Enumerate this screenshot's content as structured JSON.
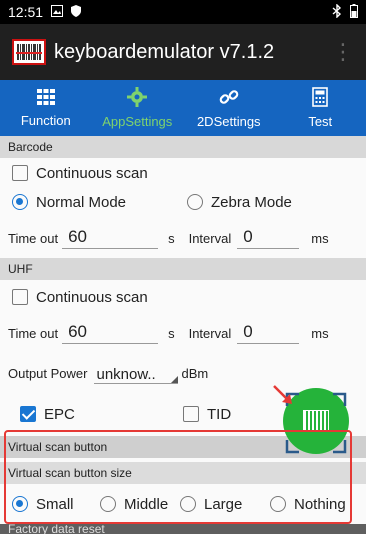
{
  "status_bar": {
    "time": "12:51",
    "icons_left": [
      "image-icon",
      "shield-icon"
    ],
    "icons_right": [
      "bluetooth-icon",
      "battery-icon"
    ]
  },
  "app_bar": {
    "title": "keyboardemulator v7.1.2"
  },
  "tabs": [
    {
      "label": "Function",
      "icon": "grid-icon",
      "active": false
    },
    {
      "label": "AppSettings",
      "icon": "gear-icon",
      "active": true
    },
    {
      "label": "2DSettings",
      "icon": "link-icon",
      "active": false
    },
    {
      "label": "Test",
      "icon": "calculator-icon",
      "active": false
    }
  ],
  "barcode": {
    "header": "Barcode",
    "continuous_scan_label": "Continuous scan",
    "continuous_scan_checked": false,
    "modes": [
      {
        "label": "Normal Mode",
        "selected": true
      },
      {
        "label": "Zebra Mode",
        "selected": false
      }
    ],
    "timeout_label": "Time out",
    "timeout_value": "60",
    "timeout_unit": "s",
    "interval_label": "Interval",
    "interval_value": "0",
    "interval_unit": "ms"
  },
  "uhf": {
    "header": "UHF",
    "continuous_scan_label": "Continuous scan",
    "continuous_scan_checked": false,
    "timeout_label": "Time out",
    "timeout_value": "60",
    "timeout_unit": "s",
    "interval_label": "Interval",
    "interval_value": "0",
    "interval_unit": "ms",
    "output_power_label": "Output Power",
    "output_power_value": "unknow..",
    "output_power_unit": "dBm",
    "epc_label": "EPC",
    "epc_checked": true,
    "tid_label": "TID",
    "tid_checked": false
  },
  "virtual_scan": {
    "header": "Virtual scan button",
    "size_header": "Virtual scan button size",
    "sizes": [
      {
        "label": "Small",
        "selected": true
      },
      {
        "label": "Middle",
        "selected": false
      },
      {
        "label": "Large",
        "selected": false
      },
      {
        "label": "Nothing",
        "selected": false
      }
    ]
  },
  "factory_reset": {
    "header": "Factory data reset"
  },
  "colors": {
    "tab_bar": "#1565c0",
    "active_tab": "#7fd36d",
    "accent": "#1976d2",
    "highlight": "#e53935",
    "overlay_button": "#25b33a"
  }
}
